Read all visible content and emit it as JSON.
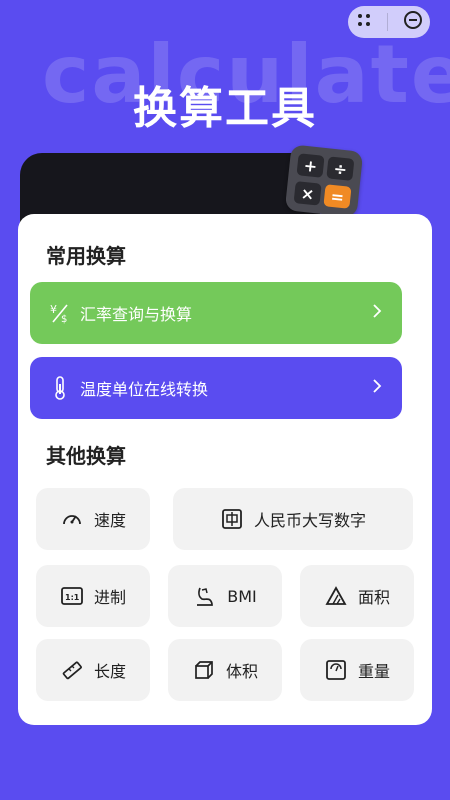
{
  "header": {
    "bg_word": "calculate",
    "title": "换算工具"
  },
  "calculator_keys": [
    "+",
    "÷",
    "×",
    "="
  ],
  "common": {
    "title": "常用换算",
    "items": [
      {
        "label": "汇率查询与换算",
        "color": "#74c95a",
        "icon": "currency-exchange-icon"
      },
      {
        "label": "温度单位在线转换",
        "color": "#5a4cf0",
        "icon": "thermometer-icon"
      }
    ]
  },
  "other": {
    "title": "其他换算",
    "items": [
      {
        "label": "速度",
        "icon": "speedometer-icon"
      },
      {
        "label": "人民币大写数字",
        "icon": "chinese-numeral-icon"
      },
      {
        "label": "进制",
        "icon": "ratio-icon"
      },
      {
        "label": "BMI",
        "icon": "body-mass-icon"
      },
      {
        "label": "面积",
        "icon": "area-icon"
      },
      {
        "label": "长度",
        "icon": "ruler-icon"
      },
      {
        "label": "体积",
        "icon": "cube-icon"
      },
      {
        "label": "重量",
        "icon": "scale-icon"
      }
    ]
  },
  "colors": {
    "background": "#5a4cf0",
    "green": "#74c95a",
    "purple": "#5a4cf0",
    "tile": "#f2f2f2",
    "orange_key": "#f08a24"
  }
}
